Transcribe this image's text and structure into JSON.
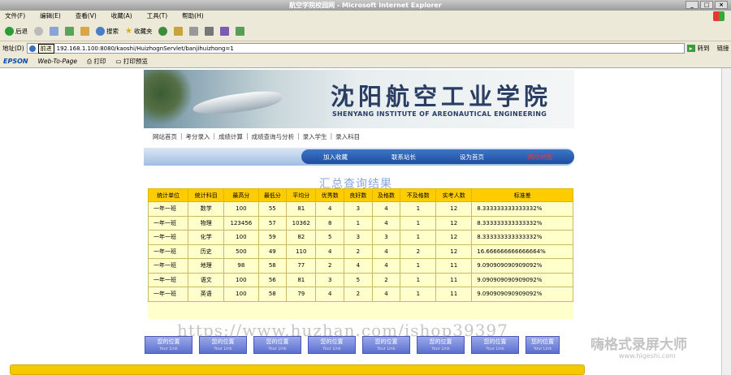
{
  "window": {
    "title": "航空学院校园网 - Microsoft Internet Explorer"
  },
  "menu": [
    "文件(F)",
    "编辑(E)",
    "查看(V)",
    "收藏(A)",
    "工具(T)",
    "帮助(H)"
  ],
  "toolbar": {
    "back": "后退",
    "search": "搜索",
    "favorites": "收藏夹"
  },
  "address": {
    "label": "地址(D)",
    "tooltip": "前进",
    "url": "192.168.1.100:8080/kaoshi/HuizhognServlet/banjihuizhong=1",
    "go": "转到",
    "links": "链接"
  },
  "linksbar": {
    "epson": "EPSON",
    "webtopage": "Web-To-Page",
    "print": "打印",
    "printpreview": "打印预览"
  },
  "banner": {
    "cn": "沈阳航空工业学院",
    "en": "SHENYANG INSTITUTE OF AREONAUTICAL ENGINEERING"
  },
  "nav": [
    "网站首页",
    "考分录入",
    "成绩计算",
    "成绩查询与分析",
    "录入学生",
    "录入科目"
  ],
  "pill": {
    "fav": "加入收藏",
    "contact": "联系站长",
    "home": "设为首页",
    "extra": "网站地图"
  },
  "result_title": "汇总查询结果",
  "table": {
    "headers": [
      "统计单位",
      "统计科目",
      "最高分",
      "最低分",
      "平均分",
      "优秀数",
      "良好数",
      "及格数",
      "不及格数",
      "实考人数",
      "标准差"
    ],
    "rows": [
      [
        "一年一班",
        "数学",
        "100",
        "55",
        "81",
        "4",
        "3",
        "4",
        "1",
        "12",
        "8.333333333333332%"
      ],
      [
        "一年一班",
        "物理",
        "123456",
        "57",
        "10362",
        "8",
        "1",
        "4",
        "1",
        "12",
        "8.333333333333332%"
      ],
      [
        "一年一班",
        "化学",
        "100",
        "59",
        "82",
        "5",
        "3",
        "3",
        "1",
        "12",
        "8.333333333333332%"
      ],
      [
        "一年一班",
        "历史",
        "500",
        "49",
        "110",
        "4",
        "2",
        "4",
        "2",
        "12",
        "16.666666666666664%"
      ],
      [
        "一年一班",
        "地理",
        "98",
        "58",
        "77",
        "2",
        "4",
        "4",
        "1",
        "11",
        "9.090909090909092%"
      ],
      [
        "一年一班",
        "语文",
        "100",
        "56",
        "81",
        "3",
        "5",
        "2",
        "1",
        "11",
        "9.090909090909092%"
      ],
      [
        "一年一班",
        "英语",
        "100",
        "58",
        "79",
        "4",
        "2",
        "4",
        "1",
        "11",
        "9.090909090909092%"
      ]
    ]
  },
  "links": [
    {
      "cn": "您的位置",
      "en": "Your Link"
    },
    {
      "cn": "您的位置",
      "en": "Your Link"
    },
    {
      "cn": "您的位置",
      "en": "Your Link"
    },
    {
      "cn": "您的位置",
      "en": "Your Link"
    },
    {
      "cn": "您的位置",
      "en": "Your Link"
    },
    {
      "cn": "您的位置",
      "en": "Your Link"
    },
    {
      "cn": "您的位置",
      "en": "Your Link"
    },
    {
      "cn": "您的位置",
      "en": "Your Link"
    }
  ],
  "watermark": {
    "url": "https://www.huzhan.com/ishop39397",
    "brand": "嗨格式录屏大师",
    "site": "www.higeshi.com"
  },
  "colors": {
    "header_yellow": "#ffcc00",
    "row_yellow": "#ffffcc",
    "nav_blue": "#1e4da0"
  }
}
